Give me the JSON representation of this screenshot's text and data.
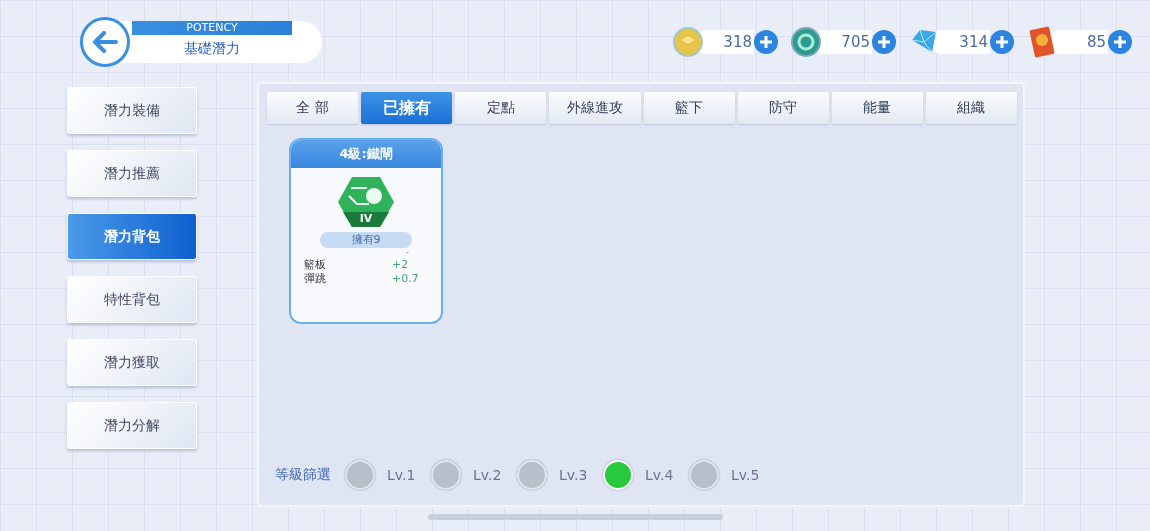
{
  "header": {
    "subtitle": "POTENCY",
    "title": "基礎潛力"
  },
  "currencies": [
    {
      "kind": "gold",
      "amount": "318"
    },
    {
      "kind": "swirl",
      "amount": "705"
    },
    {
      "kind": "gem",
      "amount": "314"
    },
    {
      "kind": "card",
      "amount": "85"
    }
  ],
  "sidebar": {
    "items": [
      {
        "label": "潛力裝備",
        "selected": false
      },
      {
        "label": "潛力推薦",
        "selected": false
      },
      {
        "label": "潛力背包",
        "selected": true
      },
      {
        "label": "特性背包",
        "selected": false
      },
      {
        "label": "潛力獲取",
        "selected": false
      },
      {
        "label": "潛力分解",
        "selected": false
      }
    ]
  },
  "tabs": [
    {
      "label": "全 部",
      "selected": false
    },
    {
      "label": "已擁有",
      "selected": true
    },
    {
      "label": "定點",
      "selected": false
    },
    {
      "label": "外線進攻",
      "selected": false
    },
    {
      "label": "籃下",
      "selected": false
    },
    {
      "label": "防守",
      "selected": false
    },
    {
      "label": "能量",
      "selected": false
    },
    {
      "label": "組織",
      "selected": false
    }
  ],
  "cards": [
    {
      "title": "4級:鐵閘",
      "grade": "IV",
      "owned": "擁有9",
      "marker": "-",
      "stats": [
        {
          "name": "籃板",
          "value": "+2"
        },
        {
          "name": "彈跳",
          "value": "+0.7"
        }
      ]
    }
  ],
  "filter": {
    "label": "等級篩選",
    "levels": [
      {
        "label": "Lv.1",
        "selected": false
      },
      {
        "label": "Lv.2",
        "selected": false
      },
      {
        "label": "Lv.3",
        "selected": false
      },
      {
        "label": "Lv.4",
        "selected": true
      },
      {
        "label": "Lv.5",
        "selected": false
      }
    ]
  }
}
